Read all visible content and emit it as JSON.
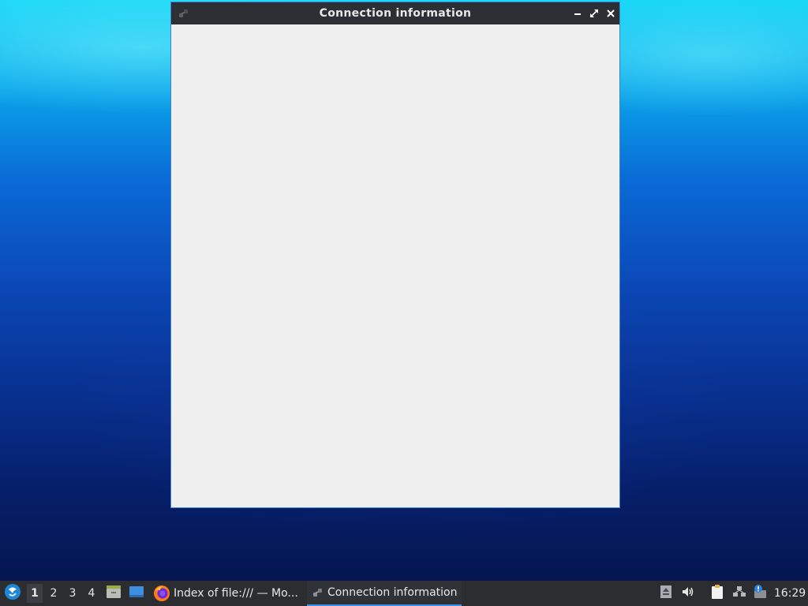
{
  "window": {
    "title": "Connection information",
    "app_icon": "network-connection-icon",
    "controls": {
      "minimize": "minimize-icon",
      "maximize": "maximize-icon",
      "close": "close-icon"
    }
  },
  "taskbar": {
    "start_icon": "lxqt-start-menu-icon",
    "workspaces": [
      "1",
      "2",
      "3",
      "4"
    ],
    "active_workspace": "1",
    "quick_launch": [
      {
        "name": "file-manager-icon"
      },
      {
        "name": "show-desktop-icon"
      }
    ],
    "tasks": [
      {
        "label": "Index of file:/// — Mo...",
        "icon": "firefox-icon",
        "active": false
      },
      {
        "label": "Connection information",
        "icon": "network-connection-icon",
        "active": true
      }
    ],
    "tray": [
      {
        "name": "tray-expand-icon"
      },
      {
        "name": "volume-icon"
      },
      {
        "name": "clipboard-icon"
      },
      {
        "name": "network-icon"
      },
      {
        "name": "update-notifier-icon"
      }
    ],
    "clock": "16:29"
  },
  "colors": {
    "titlebar": "#2c2f33",
    "window_bg": "#efefef",
    "window_border": "#3c82d8",
    "taskbar": "#2b2d31",
    "active_task_underline": "#3c8ee6"
  }
}
